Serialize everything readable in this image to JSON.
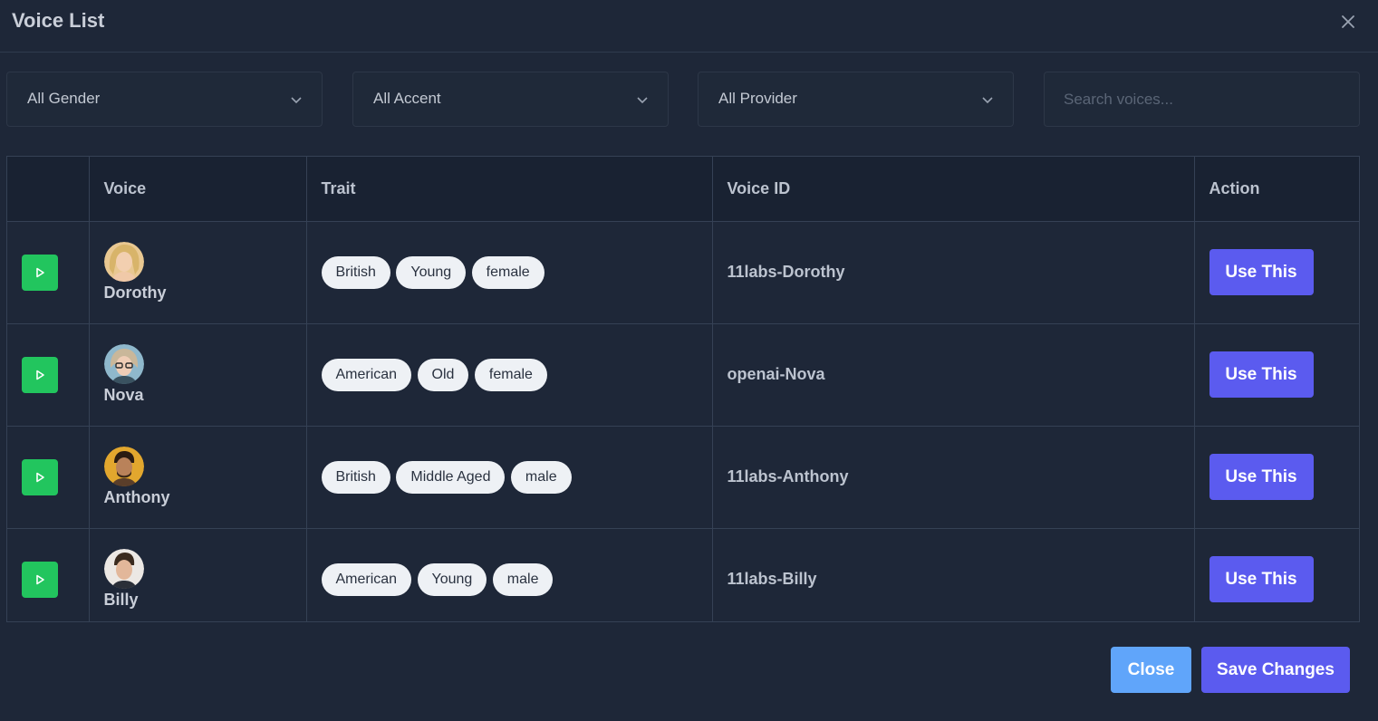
{
  "modal": {
    "title": "Voice List",
    "close_icon": "close-icon"
  },
  "filters": {
    "gender": "All Gender",
    "accent": "All Accent",
    "provider": "All Provider",
    "search_placeholder": "Search voices...",
    "search_value": ""
  },
  "table": {
    "headers": [
      "",
      "Voice",
      "Trait",
      "Voice ID",
      "Action"
    ],
    "rows": [
      {
        "name": "Dorothy",
        "traits": [
          "British",
          "Young",
          "female"
        ],
        "voice_id": "11labs-Dorothy",
        "action": "Use This"
      },
      {
        "name": "Nova",
        "traits": [
          "American",
          "Old",
          "female"
        ],
        "voice_id": "openai-Nova",
        "action": "Use This"
      },
      {
        "name": "Anthony",
        "traits": [
          "British",
          "Middle Aged",
          "male"
        ],
        "voice_id": "11labs-Anthony",
        "action": "Use This"
      },
      {
        "name": "Billy",
        "traits": [
          "American",
          "Young",
          "male"
        ],
        "voice_id": "11labs-Billy",
        "action": "Use This"
      }
    ]
  },
  "footer": {
    "close_label": "Close",
    "save_label": "Save Changes"
  },
  "colors": {
    "background": "#1e2738",
    "play_button": "#22c55e",
    "primary_button": "#5b5bef",
    "close_button": "#60a5fa"
  }
}
